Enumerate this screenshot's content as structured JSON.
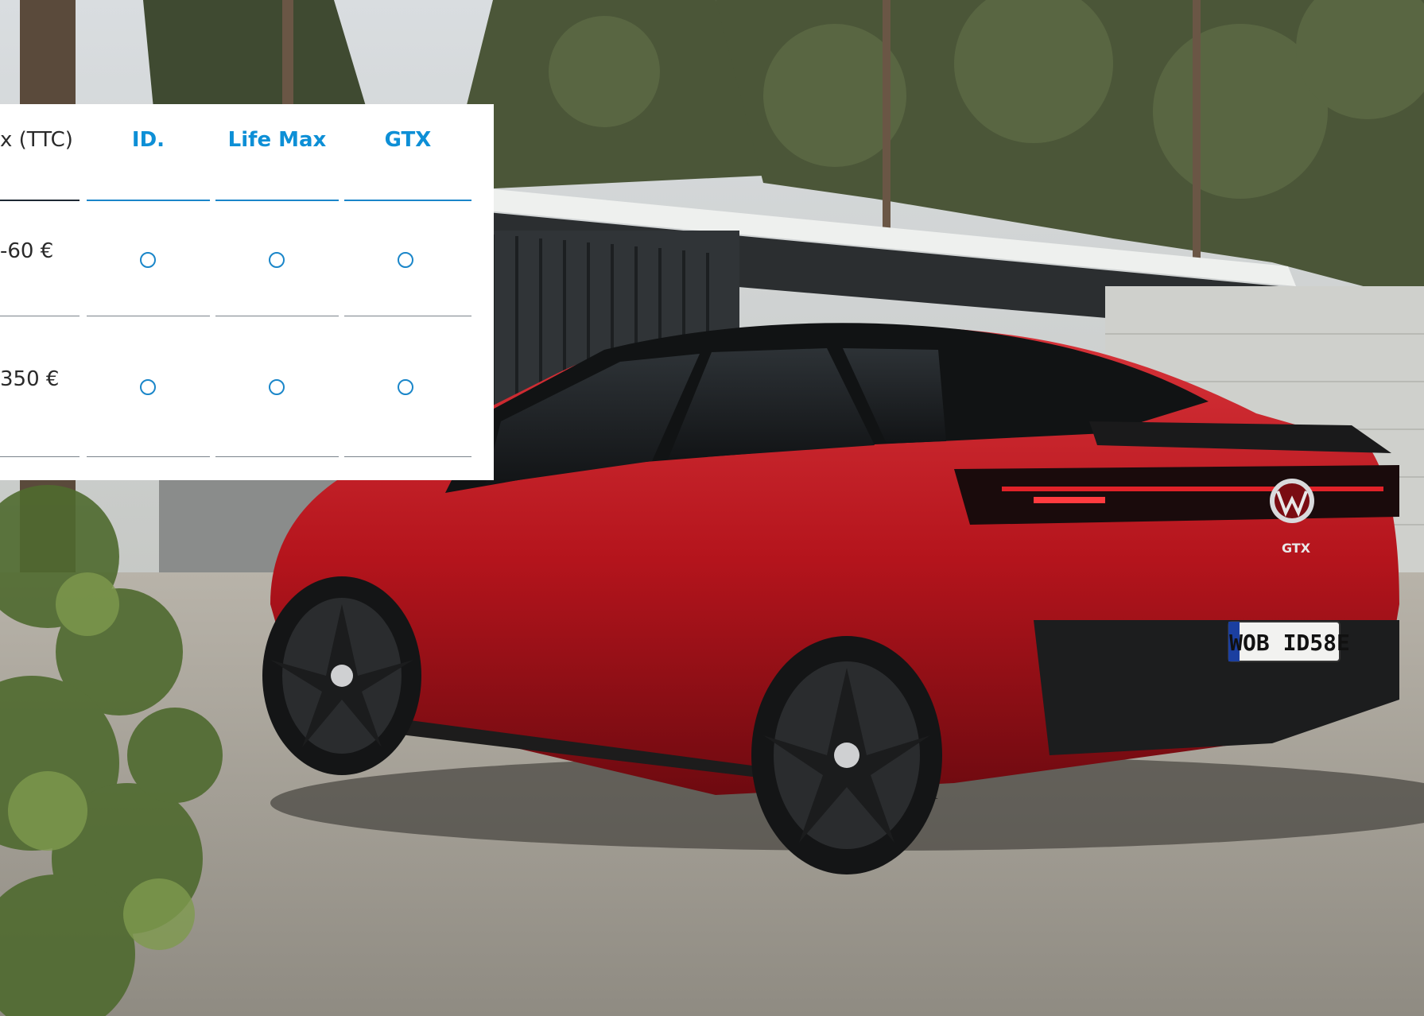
{
  "table": {
    "headers": {
      "price": "x (TTC)",
      "col1": "ID.",
      "col2": "Life Max",
      "col3": "GTX"
    },
    "rows": [
      {
        "price": "-60 €"
      },
      {
        "price": "350 €"
      }
    ]
  },
  "plate": "WOB ID58E",
  "badge": "GTX",
  "colors": {
    "accent": "#0d8fd6",
    "car_body": "#b4141c",
    "header_rule": "#1e2833"
  },
  "icons": [
    "radio-button-icon",
    "vw-logo-icon"
  ]
}
